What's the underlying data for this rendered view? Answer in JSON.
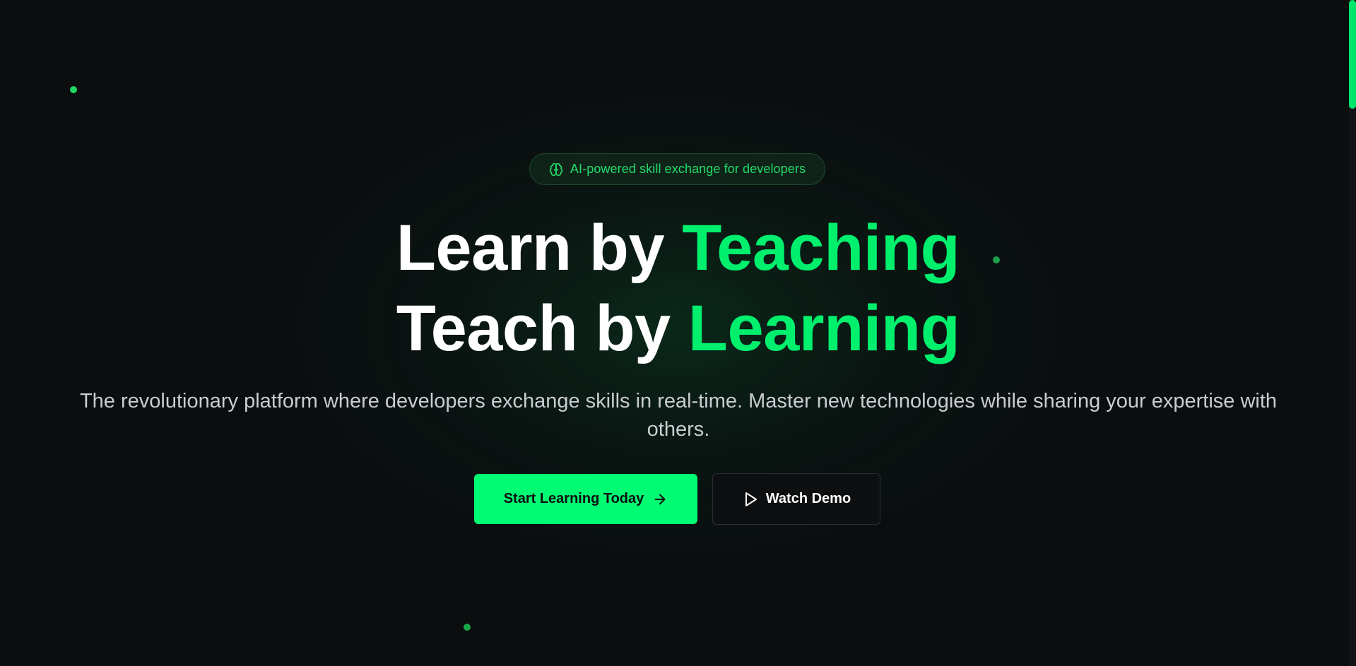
{
  "hero": {
    "badge_text": "AI-powered skill exchange for developers",
    "headline_line1_white": "Learn by",
    "headline_line1_green": "Teaching",
    "headline_line2_white": "Teach by",
    "headline_line2_green": "Learning",
    "subtitle": "The revolutionary platform where developers exchange skills in real-time. Master new technologies while sharing your expertise with others."
  },
  "actions": {
    "primary_label": "Start Learning Today",
    "secondary_label": "Watch Demo"
  },
  "icons": {
    "badge": "brain-icon",
    "primary": "arrow-right-icon",
    "secondary": "play-icon"
  },
  "colors": {
    "accent": "#00fc72",
    "background": "#0b0d0f",
    "text": "#ffffff",
    "muted_text": "#c9ccd0"
  }
}
